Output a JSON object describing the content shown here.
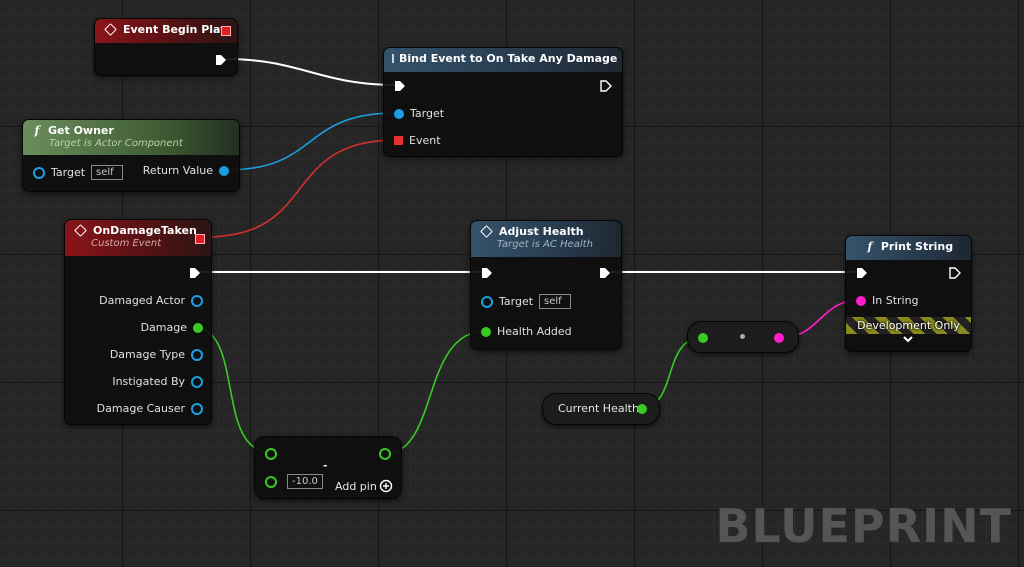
{
  "watermark": "BLUEPRINT",
  "nodes": {
    "event_begin_play": {
      "title": "Event Begin Play"
    },
    "bind_event": {
      "title": "Bind Event to On Take Any Damage",
      "pins": {
        "target": "Target",
        "event": "Event"
      }
    },
    "get_owner": {
      "title": "Get Owner",
      "subtitle": "Target is Actor Component",
      "pins": {
        "target": "Target",
        "target_value": "self",
        "return_value": "Return Value"
      }
    },
    "on_damage_taken": {
      "title": "OnDamageTaken",
      "subtitle": "Custom Event",
      "pins": {
        "damaged_actor": "Damaged Actor",
        "damage": "Damage",
        "damage_type": "Damage Type",
        "instigated_by": "Instigated By",
        "damage_causer": "Damage Causer"
      }
    },
    "adjust_health": {
      "title": "Adjust Health",
      "subtitle": "Target is AC Health",
      "pins": {
        "target": "Target",
        "target_value": "self",
        "health_added": "Health Added"
      }
    },
    "print_string": {
      "title": "Print String",
      "pins": {
        "in_string": "In String"
      },
      "dev_banner": "Development Only"
    },
    "multiply": {
      "operator": "-",
      "value": "-10.0",
      "add_pin": "Add pin"
    },
    "current_health": {
      "label": "Current Health"
    }
  },
  "colors": {
    "exec_wire": "#ffffff",
    "object_pin": "#1aa0e0",
    "float_pin": "#38c924",
    "string_pin": "#ff1ec8",
    "delegate_pin": "#e53030"
  }
}
